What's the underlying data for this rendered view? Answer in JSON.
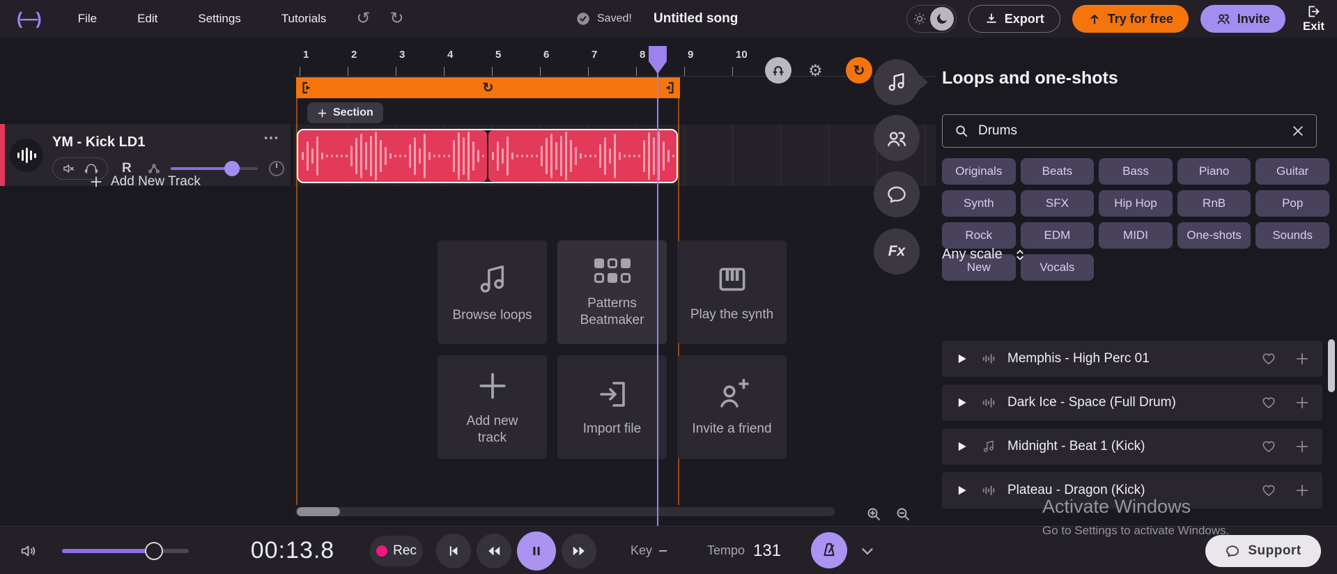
{
  "topbar": {
    "logo": "(—)",
    "menus": [
      "File",
      "Edit",
      "Settings",
      "Tutorials"
    ],
    "saved_label": "Saved!",
    "song_title": "Untitled song",
    "export_label": "Export",
    "try_label": "Try for free",
    "invite_label": "Invite",
    "exit_label": "Exit"
  },
  "track": {
    "name": "YM - Kick LD1",
    "record_arm_label": "R",
    "add_track_label": "Add New Track"
  },
  "timeline": {
    "ruler": [
      "1",
      "2",
      "3",
      "4",
      "5",
      "6",
      "7",
      "8",
      "9",
      "10"
    ],
    "section_label": "Section"
  },
  "center_actions": [
    "Browse loops",
    "Patterns Beatmaker",
    "Play the synth",
    "Add new track",
    "Import file",
    "Invite a friend"
  ],
  "floating": {
    "fx_label": "Fx"
  },
  "loops_panel": {
    "title": "Loops and one-shots",
    "search_value": "Drums",
    "chips": [
      "Originals",
      "Beats",
      "Bass",
      "Piano",
      "Guitar",
      "Synth",
      "SFX",
      "Hip Hop",
      "RnB",
      "Pop",
      "Rock",
      "EDM",
      "MIDI",
      "One-shots",
      "Sounds",
      "New",
      "Vocals"
    ],
    "scale_label": "Any scale",
    "items": [
      {
        "title": "Memphis - High Perc 01"
      },
      {
        "title": "Dark Ice - Space (Full Drum)"
      },
      {
        "title": "Midnight - Beat 1 (Kick)"
      },
      {
        "title": "Plateau - Dragon (Kick)"
      }
    ]
  },
  "transport": {
    "time": "00:13.8",
    "rec_label": "Rec",
    "key_label": "Key",
    "key_value": "–",
    "tempo_label": "Tempo",
    "tempo_value": "131"
  },
  "watermark": {
    "line1": "Activate Windows",
    "line2": "Go to Settings to activate Windows."
  },
  "support_label": "Support",
  "colors": {
    "accent_orange": "#f5740c",
    "accent_purple": "#a38df0",
    "clip_red": "#e23a58",
    "rec_pink": "#f0187c"
  }
}
